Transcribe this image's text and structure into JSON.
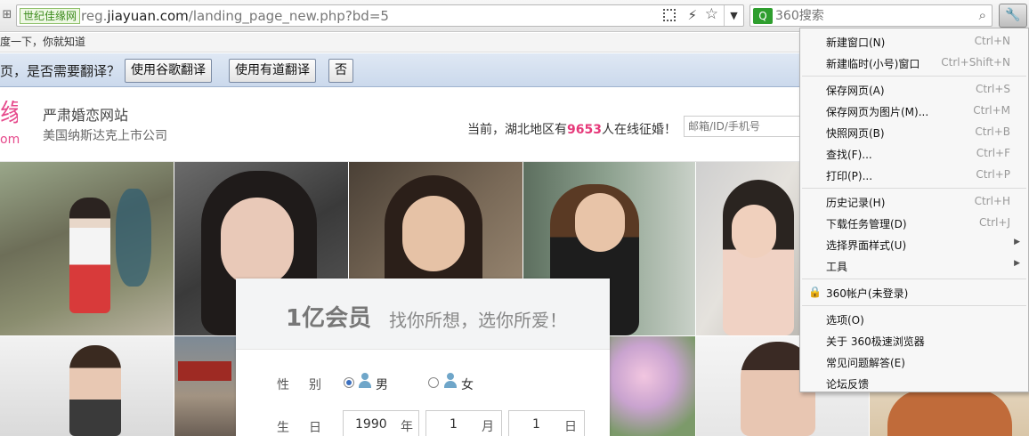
{
  "toolbar": {
    "site_badge": "世纪佳缘网",
    "url_prefix": "reg.",
    "url_domain": "jiayuan.com",
    "url_path": "/landing_page_new.php?bd=5",
    "search_engine_icon": "360-search-icon",
    "search_placeholder": "360搜索",
    "icons": [
      "qr-code-icon",
      "bolt-icon",
      "star-icon",
      "chevron-down-icon",
      "magnifier-icon",
      "wrench-icon"
    ]
  },
  "hint_bar": {
    "text": "度一下，你就知道"
  },
  "translate_bar": {
    "question": "页，是否需要翻译？",
    "google_label": "使用谷歌翻译",
    "youdao_label": "使用有道翻译",
    "no_label": "否"
  },
  "site": {
    "logo_glyph": "缘",
    "logo_sub": "om",
    "brand_title": "严肃婚恋网站",
    "brand_sub": "美国纳斯达克上市公司",
    "online_prefix": "当前，湖北地区有",
    "online_count": "9653",
    "online_suffix": "人在线征婚！",
    "login_placeholder": "邮箱/ID/手机号"
  },
  "registration": {
    "headline": "1亿会员",
    "slogan": "找你所想，选你所爱！",
    "gender_label": "性别",
    "gender_male": "男",
    "gender_female": "女",
    "selected_gender": "男",
    "birth_label": "生日",
    "birth_year": "1990",
    "year_unit": "年",
    "birth_month": "1",
    "month_unit": "月",
    "birth_day": "1",
    "day_unit": "日"
  },
  "menu": {
    "items": [
      {
        "label": "新建窗口(N)",
        "shortcut": "Ctrl+N"
      },
      {
        "label": "新建临时(小号)窗口",
        "shortcut": "Ctrl+Shift+N"
      },
      {
        "label": "保存网页(A)",
        "shortcut": "Ctrl+S"
      },
      {
        "label": "保存网页为图片(M)...",
        "shortcut": "Ctrl+M"
      },
      {
        "label": "快照网页(B)",
        "shortcut": "Ctrl+B"
      },
      {
        "label": "查找(F)...",
        "shortcut": "Ctrl+F"
      },
      {
        "label": "打印(P)...",
        "shortcut": "Ctrl+P"
      },
      {
        "label": "历史记录(H)",
        "shortcut": "Ctrl+H"
      },
      {
        "label": "下载任务管理(D)",
        "shortcut": "Ctrl+J"
      },
      {
        "label": "选择界面样式(U)",
        "shortcut": ""
      },
      {
        "label": "工具",
        "shortcut": ""
      },
      {
        "label": "360帐户(未登录)",
        "shortcut": ""
      },
      {
        "label": "选项(O)",
        "shortcut": ""
      },
      {
        "label": "关于 360极速浏览器",
        "shortcut": ""
      },
      {
        "label": "常见问题解答(E)",
        "shortcut": ""
      },
      {
        "label": "论坛反馈",
        "shortcut": ""
      }
    ]
  },
  "colors": {
    "accent_pink": "#e6397a",
    "translate_bar": "#d5e1f0",
    "menu_bg": "#f7f7f7"
  }
}
